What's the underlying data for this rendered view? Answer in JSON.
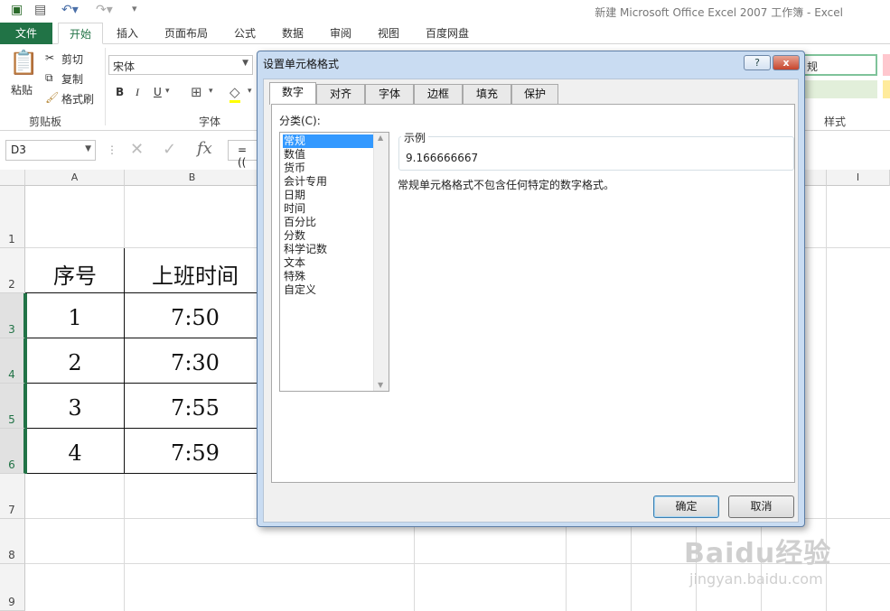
{
  "window": {
    "title": "新建 Microsoft Office Excel 2007 工作簿 - Excel"
  },
  "ribbon": {
    "tabs": [
      "文件",
      "开始",
      "插入",
      "页面布局",
      "公式",
      "数据",
      "审阅",
      "视图",
      "百度网盘"
    ],
    "clipboard": {
      "paste": "粘贴",
      "cut": "剪切",
      "copy": "复制",
      "format_painter": "格式刷",
      "group": "剪贴板"
    },
    "font": {
      "name": "宋体",
      "bold": "B",
      "italic": "I",
      "underline": "U",
      "group": "字体"
    },
    "styles": {
      "normal": "规",
      "group": "样式"
    }
  },
  "formula_bar": {
    "name_box": "D3",
    "formula_prefix": "=((",
    "fx": "fx"
  },
  "sheet": {
    "columns": [
      "A",
      "B",
      "I"
    ],
    "rows": [
      "1",
      "2",
      "3",
      "4",
      "5",
      "6",
      "7",
      "8",
      "9"
    ],
    "headers": [
      "序号",
      "上班时间"
    ],
    "data": [
      [
        "1",
        "7:50"
      ],
      [
        "2",
        "7:30"
      ],
      [
        "3",
        "7:55"
      ],
      [
        "4",
        "7:59"
      ]
    ]
  },
  "dialog": {
    "title": "设置单元格格式",
    "help": "?",
    "close": "x",
    "tabs": [
      "数字",
      "对齐",
      "字体",
      "边框",
      "填充",
      "保护"
    ],
    "category_label": "分类(C):",
    "categories": [
      "常规",
      "数值",
      "货币",
      "会计专用",
      "日期",
      "时间",
      "百分比",
      "分数",
      "科学记数",
      "文本",
      "特殊",
      "自定义"
    ],
    "sample_label": "示例",
    "sample_value": "9.166666667",
    "description": "常规单元格格式不包含任何特定的数字格式。",
    "ok": "确定",
    "cancel": "取消"
  },
  "watermark": {
    "brand": "Baidu经验",
    "url": "jingyan.baidu.com"
  }
}
